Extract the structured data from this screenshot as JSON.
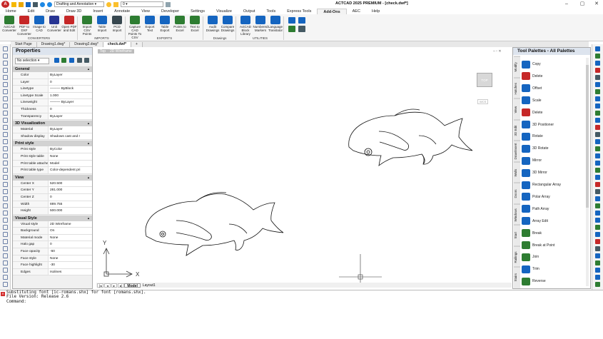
{
  "titlebar": {
    "logo": "A",
    "workspace": "Drafting and Annotation",
    "layer_value": "0",
    "title": "ACTCAD 2025 PREMIUM - [check.dwf*]",
    "minimize": "–",
    "maximize": "▢",
    "close": "✕"
  },
  "ribbon_tabs": [
    "Home",
    "Edit",
    "Draw",
    "Draw 3D",
    "Insert",
    "Annotate",
    "View",
    "Developer",
    "Settings",
    "Visualize",
    "Output",
    "Tools",
    "Express Tools",
    "Add-Ons",
    "AEC",
    "Help"
  ],
  "ribbon_active_tab": "Add-Ons",
  "ribbon": {
    "converters": [
      {
        "label": "ActCAD Converter",
        "color": "#2e7d32"
      },
      {
        "label": "PDF to DXF Converter",
        "color": "#c62828"
      },
      {
        "label": "Image to CAD",
        "color": "#1565c0"
      },
      {
        "label": "Unit Converter",
        "color": "#283593"
      },
      {
        "label": "Open PDF and Edit",
        "color": "#c62828"
      }
    ],
    "imports": [
      {
        "label": "Import CSV Points",
        "color": "#2e7d32"
      },
      {
        "label": "Table Import",
        "color": "#1565c0"
      },
      {
        "label": "PCD Import",
        "color": "#37474f"
      }
    ],
    "exports": [
      {
        "label": "Capture CAD Points To CSV",
        "color": "#2e7d32"
      },
      {
        "label": "Export Text",
        "color": "#1565c0"
      },
      {
        "label": "Table Export",
        "color": "#1565c0"
      },
      {
        "label": "Points to Excel",
        "color": "#2e7d32"
      },
      {
        "label": "Text to Excel",
        "color": "#2e7d32"
      }
    ],
    "drawings": [
      {
        "label": "Audit Drawings",
        "color": "#1565c0"
      },
      {
        "label": "Compare Drawings",
        "color": "#1565c0"
      }
    ],
    "utilities": [
      {
        "label": "ActCAD Block Library",
        "color": "#1565c0"
      },
      {
        "label": "Numbered Markers",
        "color": "#1565c0"
      },
      {
        "label": "Language Translator",
        "color": "#1565c0"
      }
    ],
    "group_labels": {
      "converters": "CONVERTERS",
      "imports": "IMPORTS",
      "exports": "EXPORTS",
      "drawings": "Drawings",
      "utilities": "UTILITIES"
    }
  },
  "doc_tabs": [
    "Start Page",
    "Drawing1.dwg*",
    "Drawing2.dwg*",
    "check.dwf*"
  ],
  "doc_active": "check.dwf*",
  "properties": {
    "title": "Properties",
    "selection": "No selection",
    "sections": [
      {
        "name": "General",
        "rows": [
          [
            "Color",
            "ByLayer"
          ],
          [
            "Layer",
            "0"
          ],
          [
            "Linetype",
            "——— ByBlock"
          ],
          [
            "Linetype Scale",
            "1.000"
          ],
          [
            "Lineweight",
            "——— ByLayer"
          ],
          [
            "Thickness",
            "0"
          ],
          [
            "Transparency",
            "ByLayer"
          ]
        ]
      },
      {
        "name": "3D Visualization",
        "rows": [
          [
            "Material",
            "ByLayer"
          ],
          [
            "Shadow display",
            "Shadows cast and r"
          ]
        ]
      },
      {
        "name": "Print style",
        "rows": [
          [
            "Print style",
            "ByColor"
          ],
          [
            "Print style table",
            "None"
          ],
          [
            "Print table attached to",
            "Model"
          ],
          [
            "Print table type",
            "Color-dependent pri"
          ]
        ]
      },
      {
        "name": "View",
        "rows": [
          [
            "Center X",
            "520.500"
          ],
          [
            "Center Y",
            "281.000"
          ],
          [
            "Center Z",
            "0"
          ],
          [
            "Width",
            "889.755"
          ],
          [
            "Height",
            "500.000"
          ]
        ]
      },
      {
        "name": "Visual Style",
        "rows": [
          [
            "Visual style",
            "2D Wireframe"
          ],
          [
            "Background",
            "On"
          ],
          [
            "Material mode",
            "None"
          ],
          [
            "Halo gap",
            "0"
          ],
          [
            "Face opacity",
            "-60"
          ],
          [
            "Face style",
            "None"
          ],
          [
            "Face highlight",
            "-30"
          ],
          [
            "Edges",
            "Isolines"
          ]
        ]
      }
    ]
  },
  "drawing": {
    "viewport_label": "Top",
    "visual_style_label": "2D Wireframe",
    "viewcube": "TOP",
    "wcs": "WCS",
    "axis_y": "Y",
    "axis_x": "X",
    "doc_controls": "– ▫ ✕"
  },
  "layout_tabs": [
    "Model",
    "Layout1"
  ],
  "layout_active": "Model",
  "tool_palette": {
    "title": "Tool Palettes - All Palettes",
    "side_tabs": [
      "Modify",
      "Hatches",
      "View",
      "3D Edit",
      "Draw/Insert",
      "Walls",
      "Doors",
      "Windows",
      "Start",
      "Railings",
      "Stairs"
    ],
    "items": [
      {
        "label": "Copy",
        "color": "#1565c0"
      },
      {
        "label": "Delete",
        "color": "#c62828"
      },
      {
        "label": "Offset",
        "color": "#1565c0"
      },
      {
        "label": "Scale",
        "color": "#1565c0"
      },
      {
        "label": "Delete",
        "color": "#c62828"
      },
      {
        "label": "3D Positioner",
        "color": "#1565c0"
      },
      {
        "label": "Rotate",
        "color": "#1565c0"
      },
      {
        "label": "3D Rotate",
        "color": "#1565c0"
      },
      {
        "label": "Mirror",
        "color": "#1565c0"
      },
      {
        "label": "3D Mirror",
        "color": "#1565c0"
      },
      {
        "label": "Rectangular Array",
        "color": "#1565c0"
      },
      {
        "label": "Polar Array",
        "color": "#1565c0"
      },
      {
        "label": "Path Array",
        "color": "#1565c0"
      },
      {
        "label": "Array Edit",
        "color": "#1565c0"
      },
      {
        "label": "Break",
        "color": "#2e7d32"
      },
      {
        "label": "Break at Point",
        "color": "#2e7d32"
      },
      {
        "label": "Join",
        "color": "#2e7d32"
      },
      {
        "label": "Trim",
        "color": "#1565c0"
      },
      {
        "label": "Reverse",
        "color": "#2e7d32"
      }
    ]
  },
  "command_line": {
    "lines": [
      "Substituting font [ic-romans.shx] for font [romans.shx].",
      "File Version: Release 2.6",
      "Command:"
    ]
  }
}
